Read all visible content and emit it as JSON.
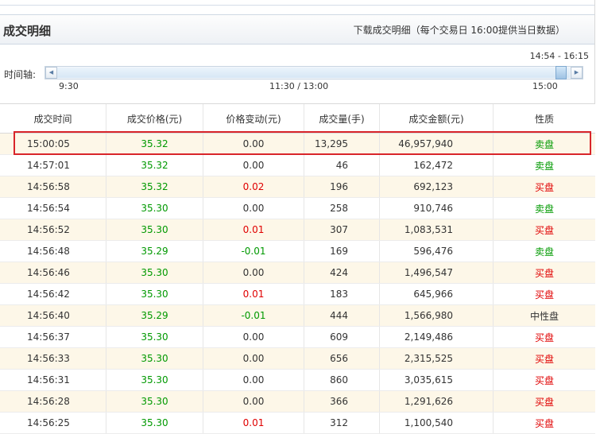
{
  "header": {
    "title": "成交明细",
    "download_text": "下载成交明细（每个交易日 16:00提供当日数据）"
  },
  "timeline": {
    "label": "时间轴:",
    "range": "14:54 - 16:15",
    "ticks": [
      "9:30",
      "11:30 / 13:00",
      "15:00"
    ],
    "left_arrow": "◀",
    "right_arrow": "▶"
  },
  "table": {
    "columns": [
      "成交时间",
      "成交价格(元)",
      "价格变动(元)",
      "成交量(手)",
      "成交金额(元)",
      "性质"
    ],
    "rows": [
      {
        "time": "15:00:05",
        "price": "35.32",
        "change": "0.00",
        "volume": "13,295",
        "amount": "46,957,940",
        "nature": "卖盘",
        "change_color": "neutral",
        "nature_color": "green"
      },
      {
        "time": "14:57:01",
        "price": "35.32",
        "change": "0.00",
        "volume": "46",
        "amount": "162,472",
        "nature": "卖盘",
        "change_color": "neutral",
        "nature_color": "green"
      },
      {
        "time": "14:56:58",
        "price": "35.32",
        "change": "0.02",
        "volume": "196",
        "amount": "692,123",
        "nature": "买盘",
        "change_color": "red",
        "nature_color": "red"
      },
      {
        "time": "14:56:54",
        "price": "35.30",
        "change": "0.00",
        "volume": "258",
        "amount": "910,746",
        "nature": "卖盘",
        "change_color": "neutral",
        "nature_color": "green"
      },
      {
        "time": "14:56:52",
        "price": "35.30",
        "change": "0.01",
        "volume": "307",
        "amount": "1,083,531",
        "nature": "买盘",
        "change_color": "red",
        "nature_color": "red"
      },
      {
        "time": "14:56:48",
        "price": "35.29",
        "change": "-0.01",
        "volume": "169",
        "amount": "596,476",
        "nature": "卖盘",
        "change_color": "green",
        "nature_color": "green"
      },
      {
        "time": "14:56:46",
        "price": "35.30",
        "change": "0.00",
        "volume": "424",
        "amount": "1,496,547",
        "nature": "买盘",
        "change_color": "neutral",
        "nature_color": "red"
      },
      {
        "time": "14:56:42",
        "price": "35.30",
        "change": "0.01",
        "volume": "183",
        "amount": "645,966",
        "nature": "买盘",
        "change_color": "red",
        "nature_color": "red"
      },
      {
        "time": "14:56:40",
        "price": "35.29",
        "change": "-0.01",
        "volume": "444",
        "amount": "1,566,980",
        "nature": "中性盘",
        "change_color": "green",
        "nature_color": "neutral"
      },
      {
        "time": "14:56:37",
        "price": "35.30",
        "change": "0.00",
        "volume": "609",
        "amount": "2,149,486",
        "nature": "买盘",
        "change_color": "neutral",
        "nature_color": "red"
      },
      {
        "time": "14:56:33",
        "price": "35.30",
        "change": "0.00",
        "volume": "656",
        "amount": "2,315,525",
        "nature": "买盘",
        "change_color": "neutral",
        "nature_color": "red"
      },
      {
        "time": "14:56:31",
        "price": "35.30",
        "change": "0.00",
        "volume": "860",
        "amount": "3,035,615",
        "nature": "买盘",
        "change_color": "neutral",
        "nature_color": "red"
      },
      {
        "time": "14:56:28",
        "price": "35.30",
        "change": "0.00",
        "volume": "366",
        "amount": "1,291,626",
        "nature": "买盘",
        "change_color": "neutral",
        "nature_color": "red"
      },
      {
        "time": "14:56:25",
        "price": "35.30",
        "change": "0.01",
        "volume": "312",
        "amount": "1,100,540",
        "nature": "买盘",
        "change_color": "red",
        "nature_color": "red"
      }
    ]
  },
  "colors": {
    "up": "#e00000",
    "down": "#009900",
    "highlight_border": "#d9252a",
    "even_row": "#fdf7e8"
  }
}
